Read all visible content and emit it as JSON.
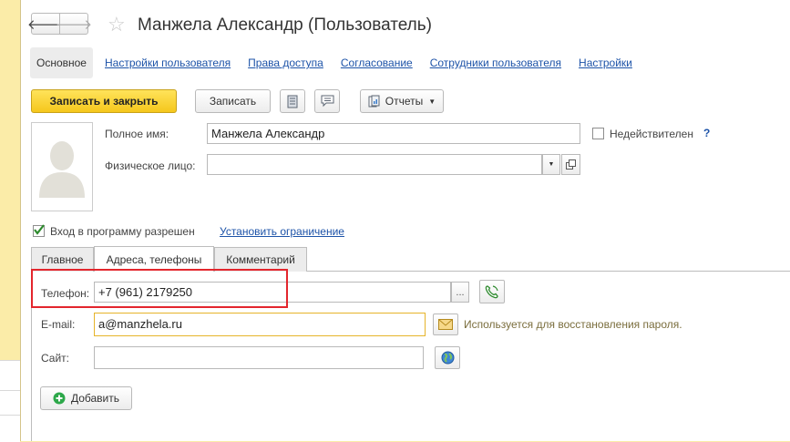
{
  "window": {
    "title": "Манжела Александр (Пользователь)"
  },
  "nav": {
    "back_glyph": "🡐",
    "forward_glyph": "🡒",
    "star_glyph": "☆"
  },
  "top_tabs": [
    {
      "label": "Основное"
    },
    {
      "label": "Настройки пользователя"
    },
    {
      "label": "Права доступа"
    },
    {
      "label": "Согласование"
    },
    {
      "label": "Сотрудники пользователя"
    },
    {
      "label": "Настройки"
    }
  ],
  "toolbar": {
    "save_close_label": "Записать и закрыть",
    "save_label": "Записать",
    "reports_label": "Отчеты"
  },
  "form": {
    "full_name_label": "Полное имя:",
    "full_name_value": "Манжела Александр",
    "person_label": "Физическое лицо:",
    "person_value": "",
    "invalid_label": "Недействителен",
    "help_mark": "?",
    "login_allowed_label": "Вход в программу разрешен",
    "login_allowed_checked": true,
    "restriction_link": "Установить ограничение"
  },
  "sub_tabs": [
    {
      "label": "Главное"
    },
    {
      "label": "Адреса, телефоны"
    },
    {
      "label": "Комментарий"
    }
  ],
  "contacts": {
    "phone_label": "Телефон:",
    "phone_value": "+7 (961) 2179250",
    "ellipsis": "...",
    "email_label": "E-mail:",
    "email_value": "a@manzhela.ru",
    "email_hint": "Используется для восстановления пароля.",
    "site_label": "Сайт:",
    "site_value": "",
    "add_label": "Добавить"
  },
  "colors": {
    "highlight": "#e3262d",
    "link": "#1d53a8",
    "primary_button": "#f5c71c",
    "background_strip": "#fbeca8"
  }
}
